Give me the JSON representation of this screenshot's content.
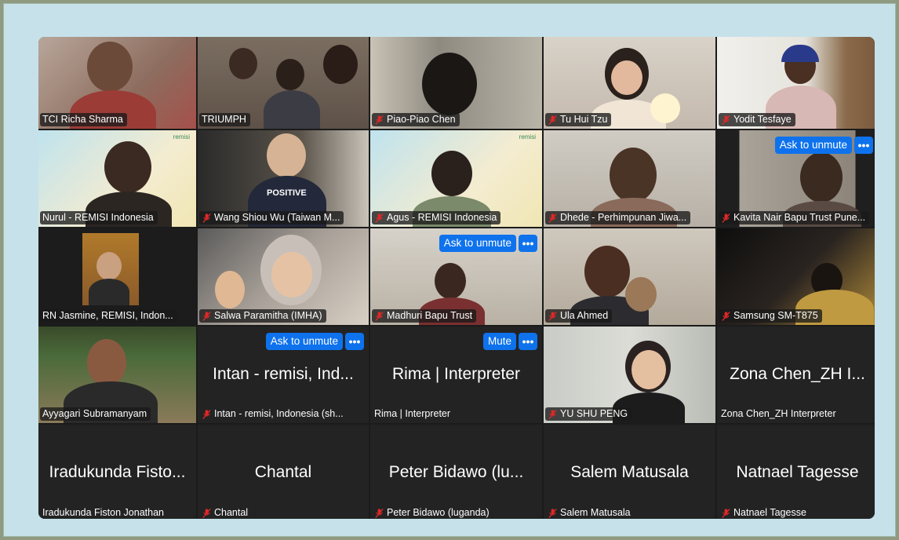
{
  "participants": [
    {
      "tile_name": "",
      "label": "TCI Richa Sharma",
      "muted": false
    },
    {
      "tile_name": "",
      "label": "TRIUMPH",
      "muted": false
    },
    {
      "tile_name": "",
      "label": "Piao-Piao  Chen",
      "muted": true
    },
    {
      "tile_name": "",
      "label": "Tu Hui Tzu",
      "muted": true
    },
    {
      "tile_name": "",
      "label": "Yodit Tesfaye",
      "muted": true
    },
    {
      "tile_name": "",
      "label": "Nurul - REMISI Indonesia",
      "muted": false
    },
    {
      "tile_name": "",
      "label": "Wang Shiou Wu  (Taiwan M...",
      "muted": true
    },
    {
      "tile_name": "",
      "label": "Agus - REMISI Indonesia",
      "muted": true
    },
    {
      "tile_name": "",
      "label": "Dhede - Perhimpunan Jiwa...",
      "muted": true
    },
    {
      "tile_name": "",
      "label": "Kavita Nair Bapu Trust Pune...",
      "muted": true
    },
    {
      "tile_name": "",
      "label": "RN Jasmine, REMISI, Indon...",
      "muted": false
    },
    {
      "tile_name": "",
      "label": "Salwa Paramitha (IMHA)",
      "muted": true
    },
    {
      "tile_name": "",
      "label": "Madhuri Bapu Trust",
      "muted": true
    },
    {
      "tile_name": "",
      "label": "Ula Ahmed",
      "muted": true
    },
    {
      "tile_name": "",
      "label": "Samsung SM-T875",
      "muted": true
    },
    {
      "tile_name": "",
      "label": "Ayyagari Subramanyam",
      "muted": false
    },
    {
      "tile_name": "Intan - remisi, Ind...",
      "label": "Intan - remisi, Indonesia (sh...",
      "muted": true
    },
    {
      "tile_name": "Rima | Interpreter",
      "label": "Rima | Interpreter",
      "muted": false
    },
    {
      "tile_name": "",
      "label": "YU SHU PENG",
      "muted": true
    },
    {
      "tile_name": "Zona Chen_ZH I...",
      "label": "Zona Chen_ZH Interpreter",
      "muted": false
    },
    {
      "tile_name": "Iradukunda Fisto...",
      "label": "Iradukunda Fiston Jonathan",
      "muted": false
    },
    {
      "tile_name": "Chantal",
      "label": "Chantal",
      "muted": true
    },
    {
      "tile_name": "Peter Bidawo (lu...",
      "label": "Peter Bidawo (luganda)",
      "muted": true
    },
    {
      "tile_name": "Salem Matusala",
      "label": "Salem Matusala",
      "muted": true
    },
    {
      "tile_name": "Natnael Tagesse",
      "label": "Natnael Tagesse",
      "muted": true
    }
  ],
  "actions": {
    "ask_to_unmute": "Ask to unmute",
    "mute": "Mute",
    "more": "•••"
  },
  "brand_small": "remisi",
  "shirt_text": "POSITIVE",
  "colors": {
    "accent": "#0e72ed",
    "muted_icon": "#e02828",
    "tile_bg": "#232323"
  }
}
